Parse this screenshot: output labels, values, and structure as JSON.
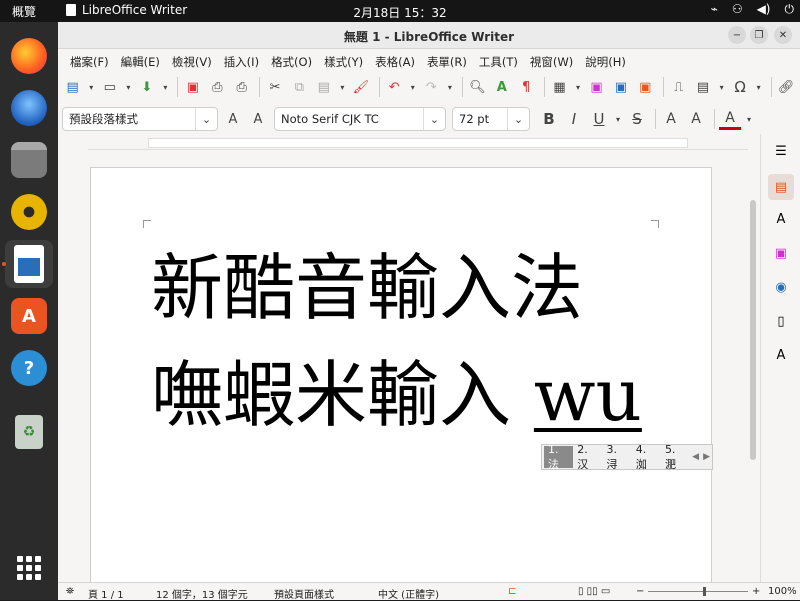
{
  "topbar": {
    "activities": "概覽",
    "app_name": "LibreOffice Writer",
    "clock": "2月18日  15：32"
  },
  "dock": {
    "items": [
      {
        "name": "firefox",
        "color": "#ff6a1f"
      },
      {
        "name": "thunderbird",
        "color": "#2a7ad4"
      },
      {
        "name": "files",
        "color": "#8a8a8a"
      },
      {
        "name": "rhythmbox",
        "color": "#e7b400"
      },
      {
        "name": "libreoffice-writer",
        "color": "#2a6ebb"
      },
      {
        "name": "app-center",
        "color": "#e95420"
      },
      {
        "name": "help",
        "color": "#2c8fd6"
      },
      {
        "name": "trash",
        "color": "#9aa49a"
      },
      {
        "name": "show-apps",
        "color": "#ffffff"
      }
    ]
  },
  "window": {
    "title": "無題 1 - LibreOffice Writer"
  },
  "menubar": {
    "items": [
      "檔案(F)",
      "編輯(E)",
      "檢視(V)",
      "插入(I)",
      "格式(O)",
      "樣式(Y)",
      "表格(A)",
      "表單(R)",
      "工具(T)",
      "視窗(W)",
      "說明(H)"
    ]
  },
  "formatbar": {
    "paragraph_style": "預設段落樣式",
    "font_name": "Noto Serif CJK TC",
    "font_size": "72 pt"
  },
  "document": {
    "line1": "新酷音輸入法",
    "line2_committed": "嘸蝦米輸入 ",
    "line2_preedit": "wu"
  },
  "candidates": {
    "items": [
      "1. 法",
      "2. 汉",
      "3. 浔",
      "4. 洳",
      "5. 淝"
    ],
    "selected_index": 0
  },
  "statusbar": {
    "page": "頁 1 / 1",
    "word_count": "12 個字，13 個字元",
    "page_style": "預設頁面樣式",
    "language": "中文 (正體字)",
    "zoom": "100%"
  },
  "colors": {
    "accent": "#e95420",
    "window_bg": "#f6f5f4",
    "dock_bg": "#2b2b2b"
  }
}
